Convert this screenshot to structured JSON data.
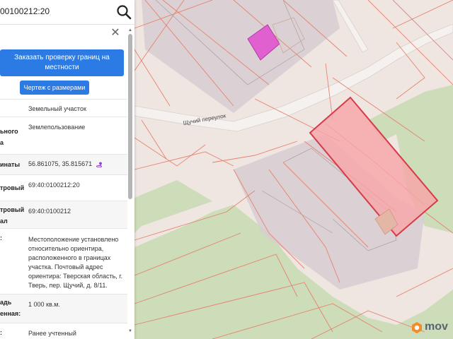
{
  "search": {
    "value": "00100212:20"
  },
  "close_symbol": "✕",
  "buttons": {
    "order_check": "Заказать проверку границ на местности",
    "drawing": "Чертеж с размерами"
  },
  "rows": [
    {
      "label": "",
      "value": "Земельный участок"
    },
    {
      "label": "ьного\nа",
      "value": "Землепользование"
    },
    {
      "label": "инаты",
      "value": "56.861075, 35.815671"
    },
    {
      "label": "тровый",
      "value": "69:40:0100212:20"
    },
    {
      "label": "тровый\nал",
      "value": "69:40:0100212"
    },
    {
      "label": ":",
      "value": "Местоположение установлено относительно ориентира, расположенного в границах участка. Почтовый адрес ориентира: Тверская область, г. Тверь, пер. Щучий, д. 8/11."
    },
    {
      "label": "адь\nенная:",
      "value": "1 000 кв.м."
    },
    {
      "label": ":",
      "value": "Ранее учтенный"
    }
  ],
  "map": {
    "street_label": "Щучий переулок",
    "brand": "mov"
  },
  "colors": {
    "primary": "#2c7be5",
    "parcel_fill": "#f7a5a8",
    "parcel_stroke": "#d63a47",
    "building_fill": "#e060d0",
    "forest": "#cddcb9",
    "background": "#efe6e2"
  },
  "icons": [
    "search-icon",
    "close-icon",
    "geo-pin-icon",
    "brand-logo-icon"
  ]
}
